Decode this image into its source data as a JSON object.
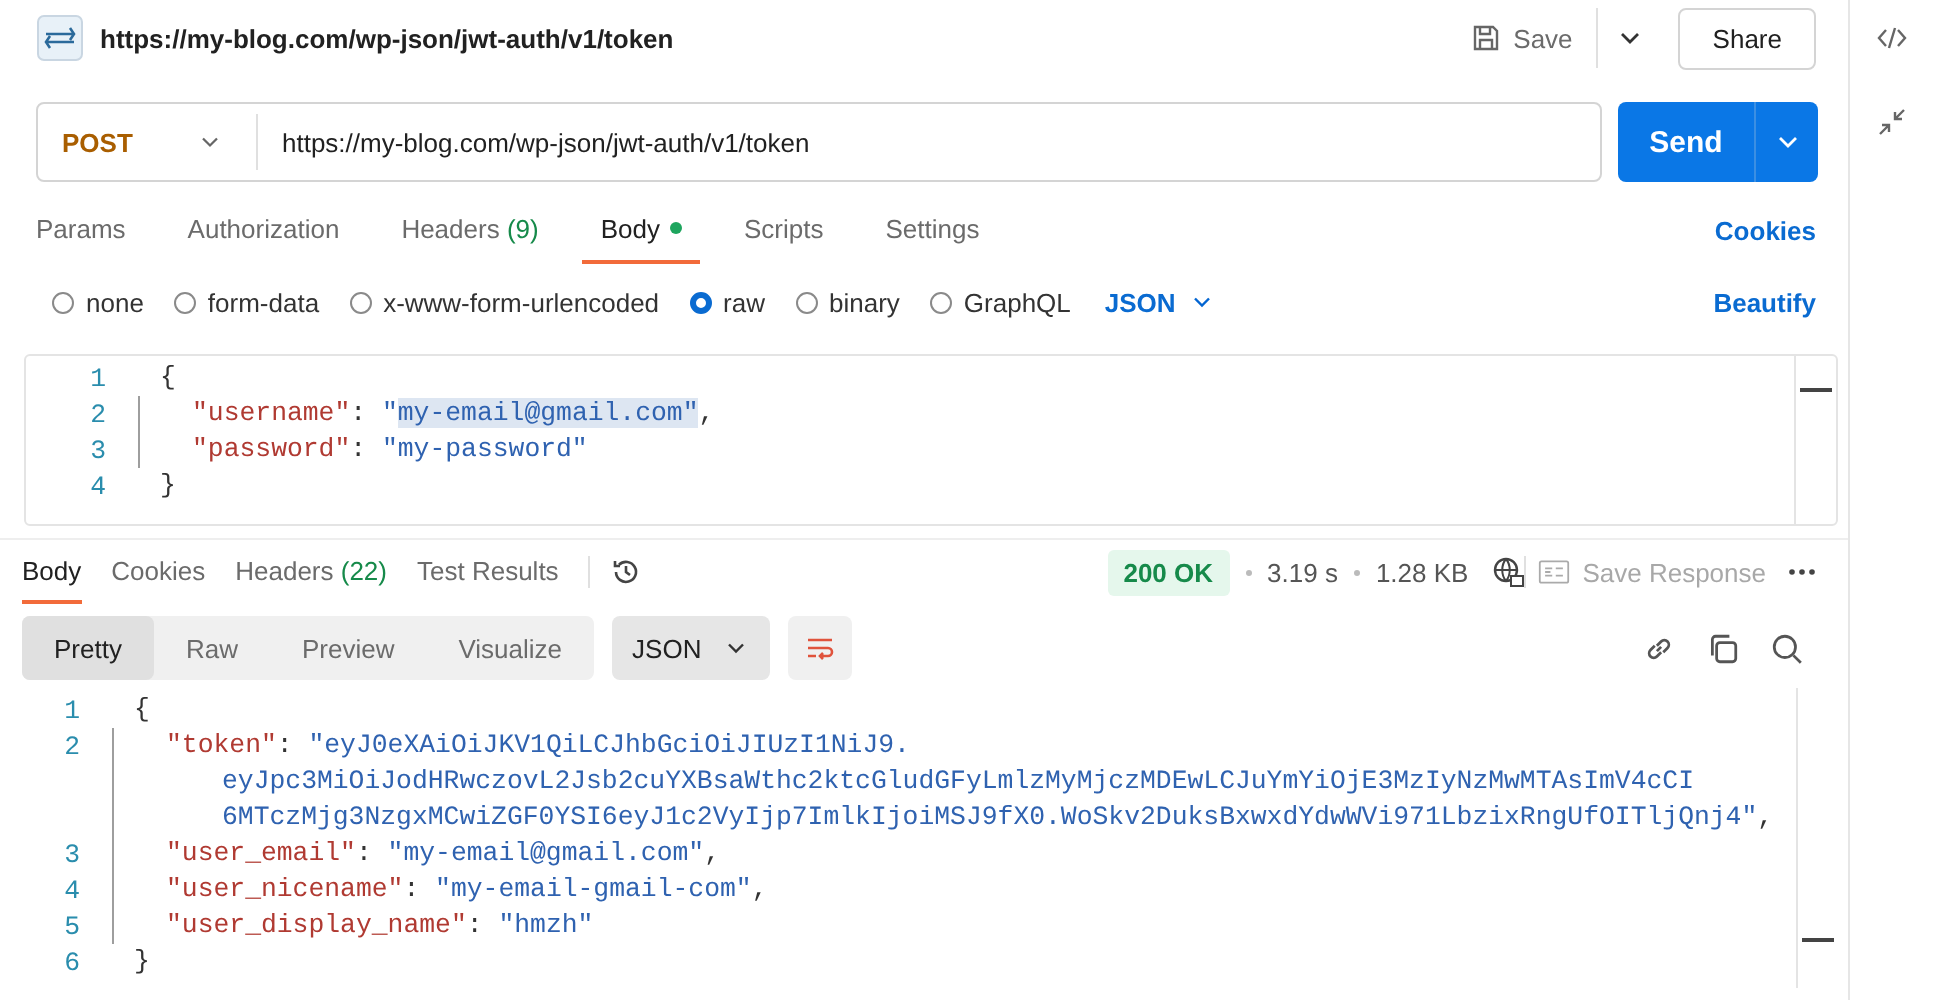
{
  "header": {
    "title": "https://my-blog.com/wp-json/jwt-auth/v1/token",
    "save": "Save",
    "share": "Share"
  },
  "request": {
    "method": "POST",
    "url": "https://my-blog.com/wp-json/jwt-auth/v1/token",
    "send": "Send"
  },
  "request_tabs": [
    {
      "label": "Params",
      "selected": false,
      "dot": false
    },
    {
      "label": "Authorization",
      "selected": false,
      "dot": false
    },
    {
      "label": "Headers",
      "count": "(9)",
      "selected": false,
      "dot": false
    },
    {
      "label": "Body",
      "selected": true,
      "dot": true
    },
    {
      "label": "Scripts",
      "selected": false,
      "dot": false
    },
    {
      "label": "Settings",
      "selected": false,
      "dot": false
    }
  ],
  "cookies_link": "Cookies",
  "body_types": [
    {
      "label": "none",
      "selected": false
    },
    {
      "label": "form-data",
      "selected": false
    },
    {
      "label": "x-www-form-urlencoded",
      "selected": false
    },
    {
      "label": "raw",
      "selected": true
    },
    {
      "label": "binary",
      "selected": false
    },
    {
      "label": "GraphQL",
      "selected": false
    }
  ],
  "body_format": "JSON",
  "beautify": "Beautify",
  "request_body": [
    {
      "number": "1",
      "parts": [
        {
          "kind": "punct",
          "text": "{"
        }
      ]
    },
    {
      "number": "2",
      "parts": [
        {
          "kind": "key",
          "text": "\"username\""
        },
        {
          "kind": "punct",
          "text": ": "
        },
        {
          "kind": "string",
          "text": "\""
        },
        {
          "kind": "selection",
          "text": "my-email@gmail.com\""
        },
        {
          "kind": "punct",
          "text": ","
        }
      ]
    },
    {
      "number": "3",
      "parts": [
        {
          "kind": "key",
          "text": "\"password\""
        },
        {
          "kind": "punct",
          "text": ": "
        },
        {
          "kind": "string",
          "text": "\"my-password\""
        }
      ]
    },
    {
      "number": "4",
      "parts": [
        {
          "kind": "punct",
          "text": "}"
        }
      ]
    }
  ],
  "response_tabs": [
    {
      "label": "Body",
      "selected": true
    },
    {
      "label": "Cookies",
      "selected": false
    },
    {
      "label": "Headers",
      "count": "(22)",
      "selected": false
    },
    {
      "label": "Test Results",
      "selected": false
    }
  ],
  "status": {
    "code": "200 OK",
    "time": "3.19 s",
    "size": "1.28 KB",
    "save_response": "Save Response"
  },
  "view_modes": [
    {
      "label": "Pretty",
      "selected": true
    },
    {
      "label": "Raw",
      "selected": false
    },
    {
      "label": "Preview",
      "selected": false
    },
    {
      "label": "Visualize",
      "selected": false
    }
  ],
  "response_format": "JSON",
  "response_body": [
    {
      "number": "1",
      "parts": [
        {
          "kind": "punct",
          "text": "{"
        }
      ]
    },
    {
      "number": "2",
      "parts": [
        {
          "kind": "key",
          "text": "\"token\""
        },
        {
          "kind": "punct",
          "text": ": "
        },
        {
          "kind": "string",
          "text": "\"eyJ0eXAiOiJKV1QiLCJhbGciOiJIUzI1NiJ9."
        }
      ],
      "continued": [
        [
          {
            "kind": "string",
            "text": "eyJpc3MiOiJodHRwczovL2Jsb2cuYXBsaWthc2ktcGludGFyLmlzMyMjczMDEwLCJuYmYiOjE3MzIyNzMwMTAsImV4cCI"
          }
        ],
        [
          {
            "kind": "string",
            "text": "6MTczMjg3NzgxMCwiZGF0YSI6eyJ1c2VyIjp7ImlkIjoiMSJ9fX0.WoSkv2DuksBxwxdYdwWVi971LbzixRngUfOITljQnj4\""
          },
          {
            "kind": "punct",
            "text": ","
          }
        ]
      ]
    },
    {
      "number": "3",
      "parts": [
        {
          "kind": "key",
          "text": "\"user_email\""
        },
        {
          "kind": "punct",
          "text": ": "
        },
        {
          "kind": "string",
          "text": "\"my-email@gmail.com\""
        },
        {
          "kind": "punct",
          "text": ","
        }
      ]
    },
    {
      "number": "4",
      "parts": [
        {
          "kind": "key",
          "text": "\"user_nicename\""
        },
        {
          "kind": "punct",
          "text": ": "
        },
        {
          "kind": "string",
          "text": "\"my-email-gmail-com\""
        },
        {
          "kind": "punct",
          "text": ","
        }
      ]
    },
    {
      "number": "5",
      "parts": [
        {
          "kind": "key",
          "text": "\"user_display_name\""
        },
        {
          "kind": "punct",
          "text": ": "
        },
        {
          "kind": "string",
          "text": "\"hmzh\""
        }
      ]
    },
    {
      "number": "6",
      "parts": [
        {
          "kind": "punct",
          "text": "}"
        }
      ]
    }
  ]
}
